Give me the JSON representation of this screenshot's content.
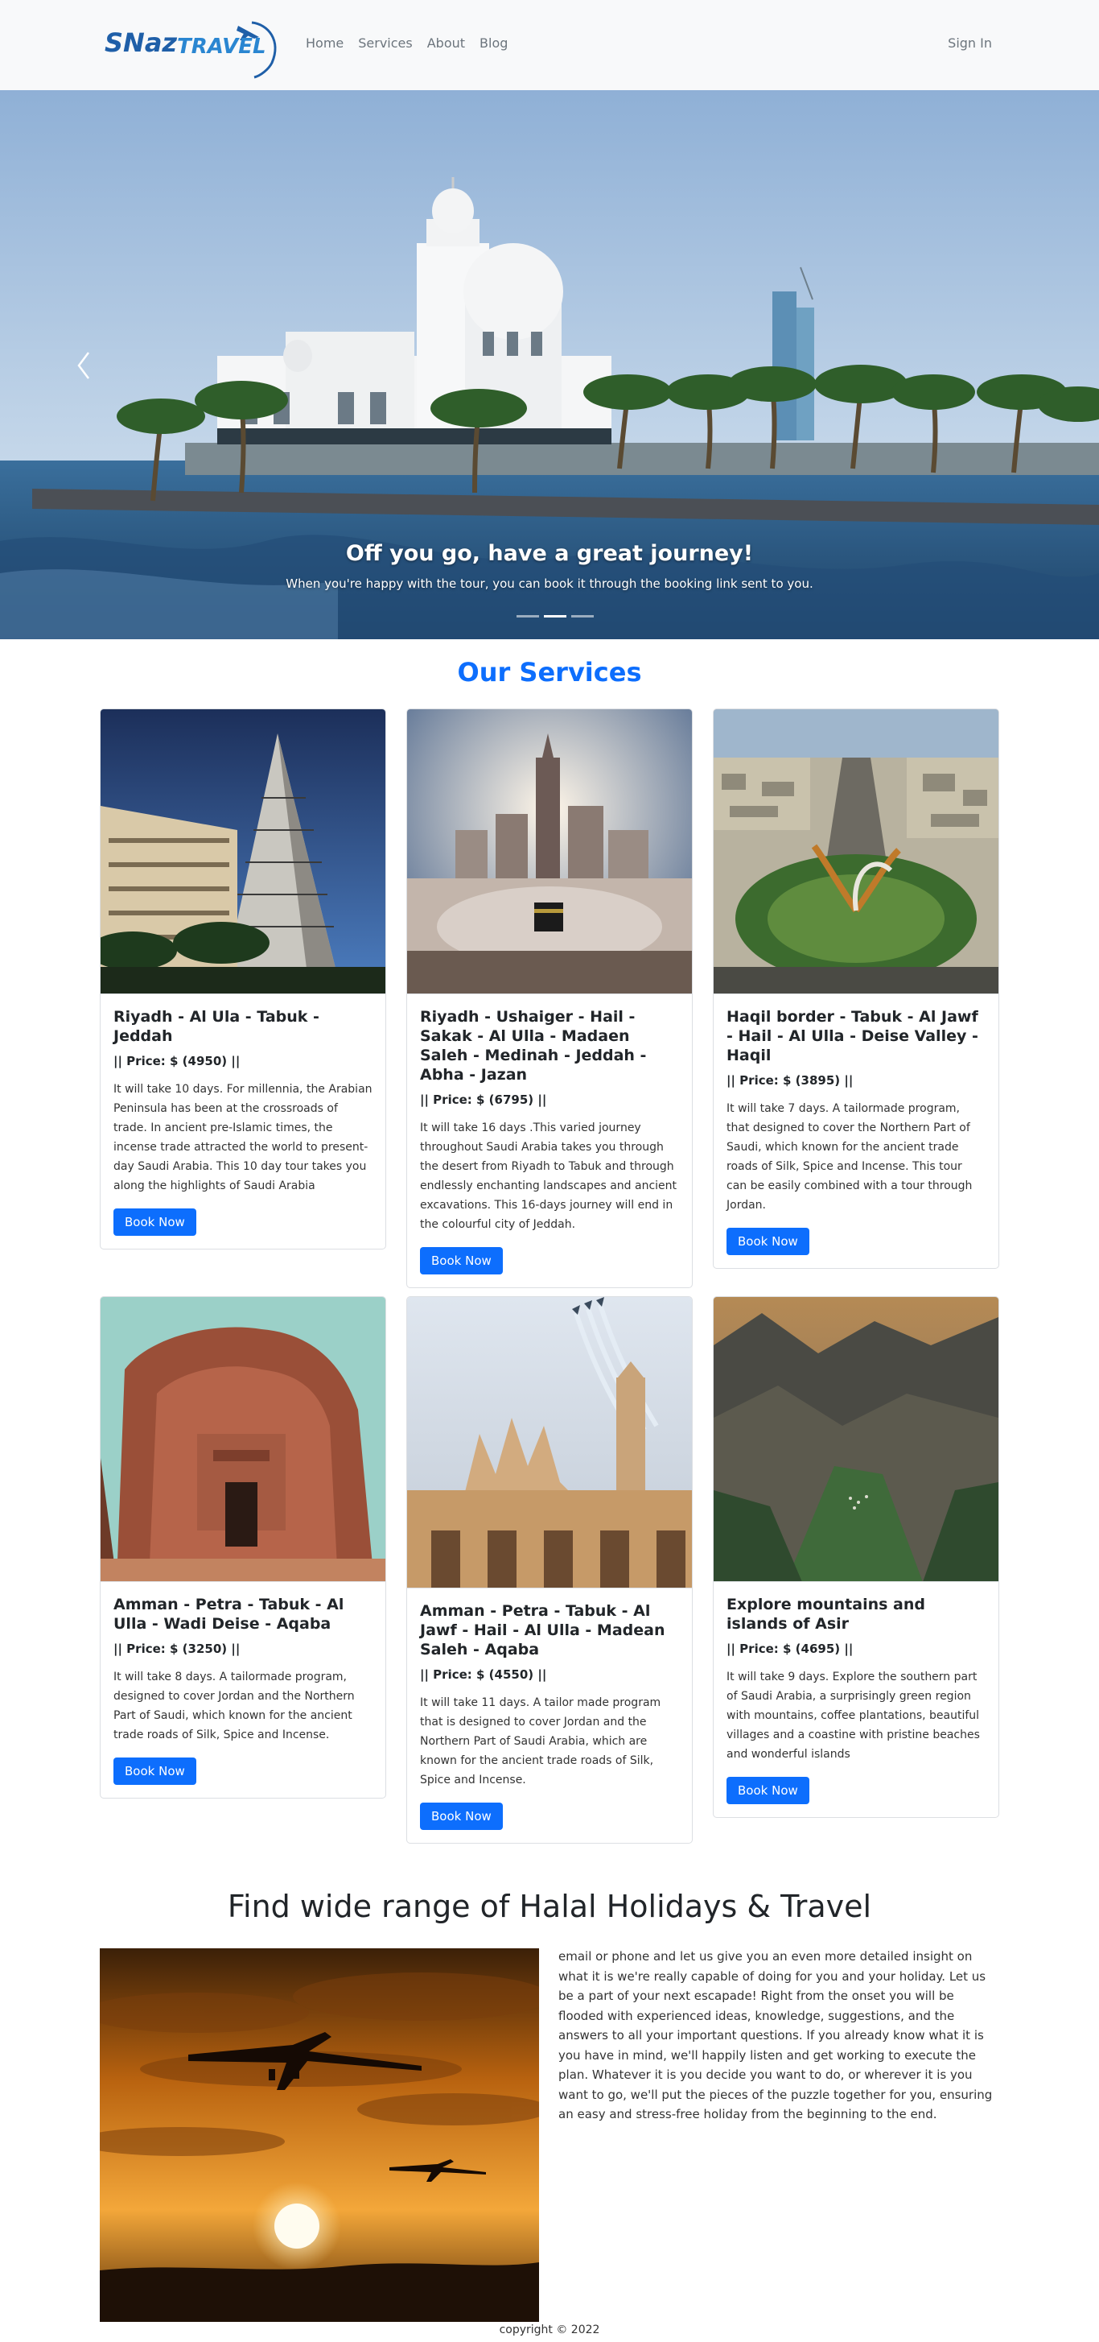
{
  "brand": {
    "name_part1": "SNaz",
    "name_part2": "TRAVEL"
  },
  "nav": {
    "links": [
      "Home",
      "Services",
      "About",
      "Blog"
    ],
    "signin": "Sign In"
  },
  "hero": {
    "title": "Off you go, have a great journey!",
    "text": "When you're happy with the tour, you can book it through the booking link sent to you.",
    "slides": 3,
    "active_slide": 1
  },
  "services": {
    "title": "Our Services",
    "cards": [
      {
        "title": "Riyadh - Al Ula - Tabuk - Jeddah",
        "price": "|| Price: $ (4950) ||",
        "desc": "It will take 10 days. For millennia, the Arabian Peninsula has been at the crossroads of trade. In ancient pre-Islamic times, the incense trade attracted the world to present-day Saudi Arabia. This 10 day tour takes you along the highlights of Saudi Arabia",
        "button": "Book Now"
      },
      {
        "title": "Riyadh - Ushaiger - Hail - Sakak - Al Ulla - Madaen Saleh - Medinah - Jeddah - Abha - Jazan",
        "price": "|| Price: $ (6795) ||",
        "desc": "It will take 16 days .This varied journey throughout Saudi Arabia takes you through the desert from Riyadh to Tabuk and through endlessly enchanting landscapes and ancient excavations. This 16-days journey will end in the colourful city of Jeddah.",
        "button": "Book Now"
      },
      {
        "title": "Haqil border - Tabuk - Al Jawf - Hail - Al Ulla - Deise Valley - Haqil",
        "price": "|| Price: $ (3895) ||",
        "desc": "It will take 7 days. A tailormade program, that designed to cover the Northern Part of Saudi, which known for the ancient trade roads of Silk, Spice and Incense. This tour can be easily combined with a tour through Jordan.",
        "button": "Book Now"
      },
      {
        "title": "Amman - Petra - Tabuk - Al Ulla - Wadi Deise - Aqaba",
        "price": "|| Price: $ (3250) ||",
        "desc": "It will take 8 days. A tailormade program, designed to cover Jordan and the Northern Part of Saudi, which known for the ancient trade roads of Silk, Spice and Incense.",
        "button": "Book Now"
      },
      {
        "title": "Amman - Petra - Tabuk - Al Jawf - Hail - Al Ulla - Madean Saleh - Aqaba",
        "price": "|| Price: $ (4550) ||",
        "desc": "It will take 11 days. A tailor made program that is designed to cover Jordan and the Northern Part of Saudi Arabia, which are known for the ancient trade roads of Silk, Spice and Incense.",
        "button": "Book Now"
      },
      {
        "title": "Explore mountains and islands of Asir",
        "price": "|| Price: $ (4695) ||",
        "desc": "It will take 9 days. Explore the southern part of Saudi Arabia, a surprisingly green region with mountains, coffee plantations, beautiful villages and a coastine with pristine beaches and wonderful islands",
        "button": "Book Now"
      }
    ]
  },
  "halal": {
    "title": "Find wide range of Halal Holidays & Travel",
    "text": "email or phone and let us give you an even more detailed insight on what it is we're really capable of doing for you and your holiday. Let us be a part of your next escapade! Right from the onset you will be flooded with experienced ideas, knowledge, suggestions, and the answers to all your important questions. If you already know what it is you have in mind, we'll happily listen and get working to execute the plan. Whatever it is you decide you want to do, or wherever it is you want to go, we'll put the pieces of the puzzle together for you, ensuring an easy and stress-free holiday from the beginning to the end."
  },
  "footer": {
    "text": "copyright © 2022"
  },
  "colors": {
    "primary": "#0d6efd",
    "navbar_bg": "#f8f9fa",
    "brand_blue": "#1f5fa8"
  }
}
